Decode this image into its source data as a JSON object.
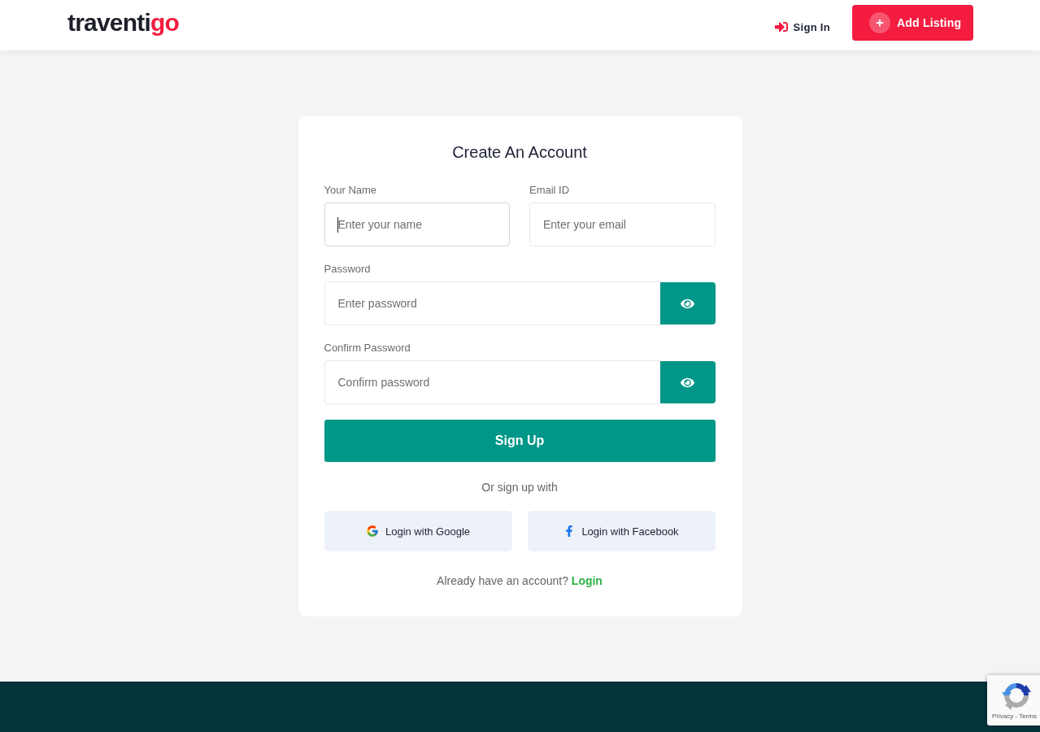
{
  "header": {
    "logo": {
      "main": "traventi",
      "accent": "go"
    },
    "sign_in": "Sign In",
    "add_listing": "Add Listing"
  },
  "form": {
    "title": "Create An Account",
    "fields": [
      {
        "kind": "text",
        "label": "Your Name",
        "placeholder": "Enter your name",
        "focused": true
      },
      {
        "kind": "text",
        "label": "Email ID",
        "placeholder": "Enter your email",
        "focused": false
      },
      {
        "kind": "password",
        "label": "Password",
        "placeholder": "Enter password",
        "focused": false
      },
      {
        "kind": "password",
        "label": "Confirm Password",
        "placeholder": "Confirm password",
        "focused": false
      }
    ],
    "submit": "Sign Up",
    "divider_text": "Or sign up with",
    "social": [
      {
        "kind": "google",
        "label": "Login with Google"
      },
      {
        "kind": "facebook",
        "label": "Login with Facebook"
      }
    ],
    "account_prompt": "Already have an account?",
    "login_link": "Login"
  },
  "recaptcha": {
    "links": "Privacy - Terms"
  }
}
